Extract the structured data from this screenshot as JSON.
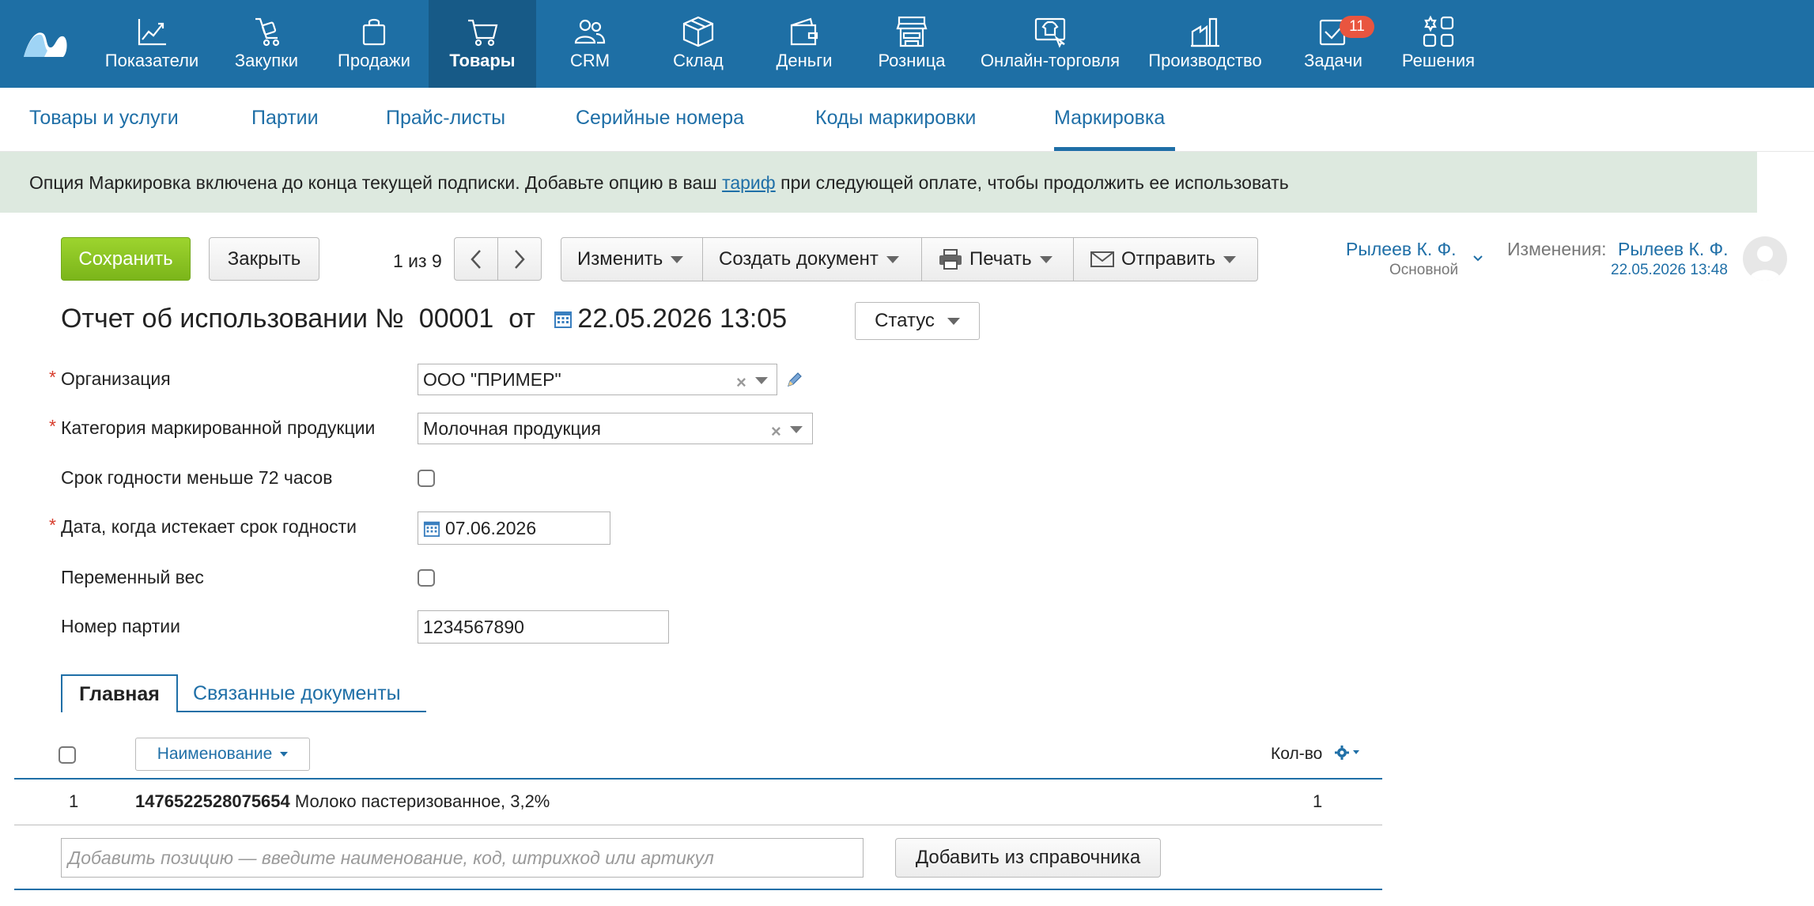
{
  "nav": {
    "items": [
      {
        "label": "Показатели",
        "icon": "chart-line-icon"
      },
      {
        "label": "Закупки",
        "icon": "cart-dolly-icon"
      },
      {
        "label": "Продажи",
        "icon": "shopping-bag-icon"
      },
      {
        "label": "Товары",
        "icon": "cart-icon",
        "active": true
      },
      {
        "label": "CRM",
        "icon": "people-icon"
      },
      {
        "label": "Склад",
        "icon": "box-icon"
      },
      {
        "label": "Деньги",
        "icon": "wallet-icon"
      },
      {
        "label": "Розница",
        "icon": "store-icon"
      },
      {
        "label": "Онлайн-торговля",
        "icon": "online-shop-icon"
      },
      {
        "label": "Производство",
        "icon": "factory-icon"
      },
      {
        "label": "Задачи",
        "icon": "tasks-check-icon",
        "badge": "11"
      },
      {
        "label": "Решения",
        "icon": "apps-grid-icon"
      }
    ]
  },
  "subnav": {
    "items": [
      "Товары и услуги",
      "Партии",
      "Прайс-листы",
      "Серийные номера",
      "Коды маркировки",
      "Маркировка"
    ],
    "active": "Маркировка"
  },
  "banner": {
    "text_before": "Опция Маркировка включена до конца текущей подписки. Добавьте опцию в ваш ",
    "link": "тариф",
    "text_after": " при следующей оплате, чтобы продолжить ее использовать"
  },
  "toolbar": {
    "save": "Сохранить",
    "close": "Закрыть",
    "pager": "1 из 9",
    "edit": "Изменить",
    "create_doc": "Создать документ",
    "print": "Печать",
    "send": "Отправить"
  },
  "user": {
    "name": "Рылеев К. Ф.",
    "role": "Основной",
    "changes_label": "Изменения:",
    "changes_user": "Рылеев К. Ф.",
    "changes_date": "22.05.2026 13:48"
  },
  "document": {
    "title_prefix": "Отчет об использовании №",
    "number": "00001",
    "from": "от",
    "datetime": "22.05.2026 13:05",
    "status": "Статус"
  },
  "form": {
    "organization_label": "Организация",
    "organization_value": "ООО \"ПРИМЕР\"",
    "category_label": "Категория маркированной продукции",
    "category_value": "Молочная продукция",
    "short_shelf_label": "Срок годности меньше 72 часов",
    "short_shelf_checked": false,
    "expiry_label": "Дата, когда истекает срок годности",
    "expiry_value": "07.06.2026",
    "variable_weight_label": "Переменный вес",
    "variable_weight_checked": false,
    "batch_label": "Номер партии",
    "batch_value": "1234567890"
  },
  "tabs": {
    "main": "Главная",
    "related": "Связанные документы"
  },
  "table": {
    "col_name": "Наименование",
    "col_qty": "Кол-во",
    "rows": [
      {
        "num": "1",
        "code": "1476522528075654",
        "name": " Молоко пастеризованное, 3,2%",
        "qty": "1"
      }
    ],
    "add_placeholder": "Добавить позицию — введите наименование, код, штрихкод или артикул",
    "add_from_catalog": "Добавить из справочника"
  },
  "colors": {
    "nav_bg": "#1e6fa5",
    "nav_active": "#175a87",
    "link": "#1f6fa7",
    "save_green": "#8cc523",
    "banner_bg": "#dde9df",
    "badge": "#e9553f"
  }
}
